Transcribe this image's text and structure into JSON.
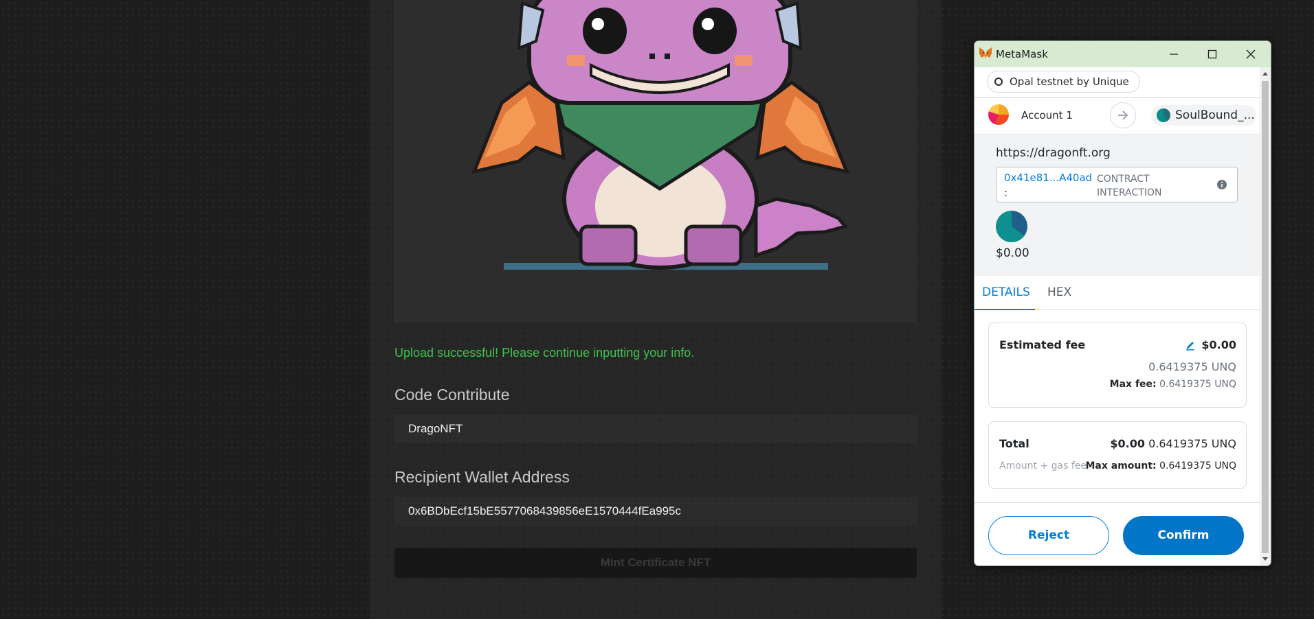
{
  "dapp": {
    "upload_message": "Upload successful! Please continue inputting your info.",
    "code_label": "Code Contribute",
    "code_value": "DragoNFT",
    "recipient_label": "Recipient Wallet Address",
    "recipient_value": "0x6BDbEcf15bE5577068439856eE1570444fEa995c",
    "mint_button": "Mint Certificate NFT",
    "nft_image": "pixel-dragon-icon"
  },
  "metamask": {
    "window_title": "MetaMask",
    "network": "Opal testnet by Unique",
    "account_name": "Account 1",
    "contract_name": "SoulBound_...",
    "origin_url": "https://dragonft.org",
    "contract_address": "0x41e81...A40ad",
    "contract_colon": ":",
    "contract_type": "CONTRACT INTERACTION",
    "value_amount": "$0.00",
    "tabs": {
      "details": "DETAILS",
      "hex": "HEX"
    },
    "fee": {
      "title": "Estimated fee",
      "fiat": "$0.00",
      "native": "0.6419375 UNQ",
      "max_label": "Max fee:",
      "max_value": "0.6419375 UNQ"
    },
    "total": {
      "title": "Total",
      "fiat": "$0.00",
      "native": "0.6419375 UNQ",
      "sub": "Amount + gas fee",
      "max_label": "Max amount:",
      "max_value": "0.6419375 UNQ"
    },
    "buttons": {
      "reject": "Reject",
      "confirm": "Confirm"
    }
  },
  "colors": {
    "success": "#3ec34a",
    "metamask_blue": "#037dd6",
    "titlebar": "#d9ead3"
  }
}
